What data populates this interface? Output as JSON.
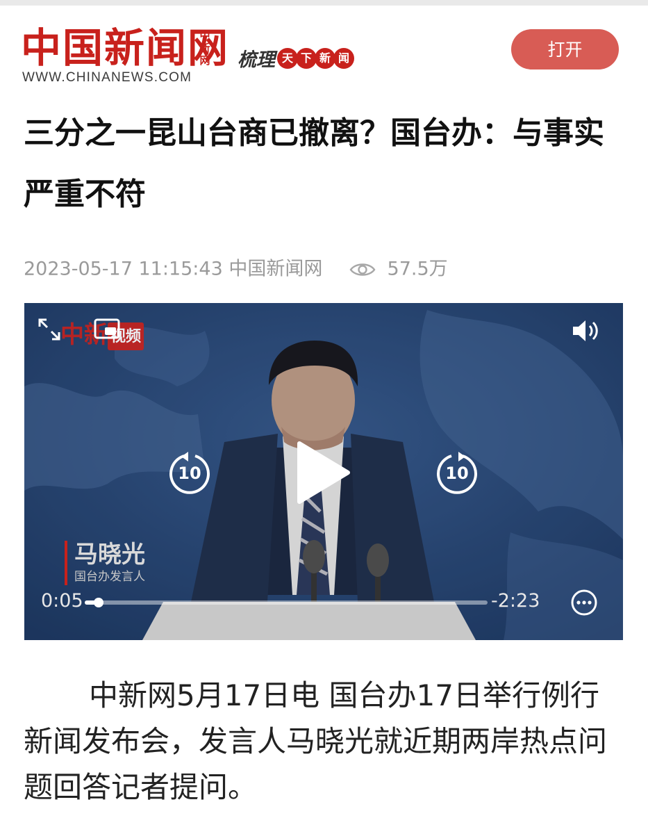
{
  "header": {
    "logo_cn": "中国新闻网",
    "logo_cn_small": [
      "中",
      "新",
      "网"
    ],
    "logo_en": "WWW.CHINANEWS.COM",
    "slogan_text": "梳理",
    "slogan_seals": [
      "天",
      "下",
      "新",
      "闻"
    ],
    "open_button_label": "打开"
  },
  "article": {
    "title": "三分之一昆山台商已撤离？国台办：与事实严重不符",
    "datetime": "2023-05-17 11:15:43",
    "source": "中国新闻网",
    "view_count": "57.5万",
    "body": "中新网5月17日电 国台办17日举行例行新闻发布会，发言人马晓光就近期两岸热点问题回答记者提问。"
  },
  "video": {
    "watermark_text": "中新",
    "watermark_tag": "视频",
    "speaker_name": "马晓光",
    "speaker_role": "国台办发言人",
    "current_time": "0:05",
    "remaining_time": "-2:23",
    "skip_back_label": "10",
    "skip_forward_label": "10",
    "progress": 0.035,
    "icons": {
      "fullscreen": "expand-icon",
      "pip": "picture-in-picture-icon",
      "volume": "volume-icon",
      "play": "play-icon",
      "rewind": "rewind-10-icon",
      "forward": "forward-10-icon",
      "more": "more-options-icon",
      "views": "eye-icon"
    }
  }
}
